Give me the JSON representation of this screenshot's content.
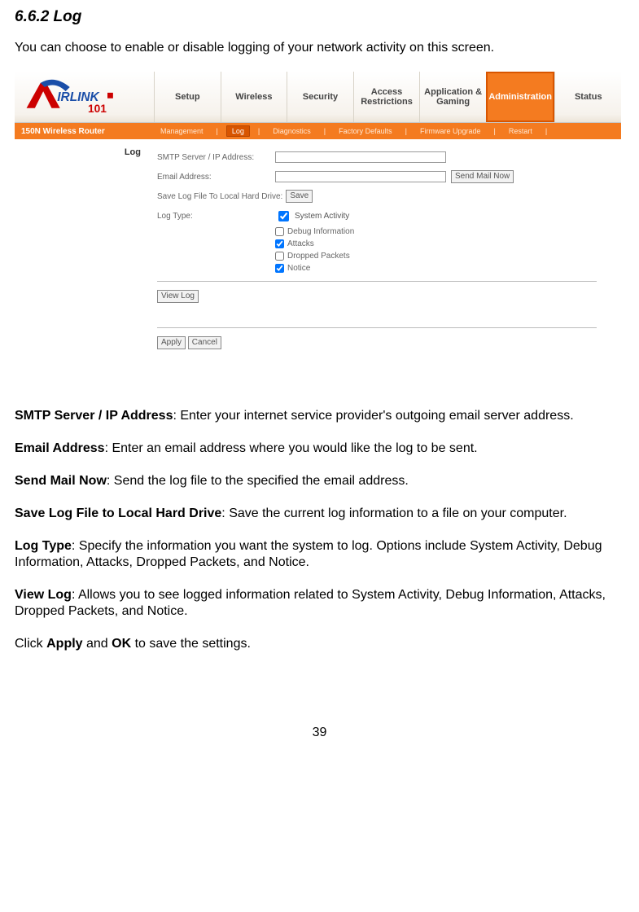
{
  "doc": {
    "heading": "6.6.2 Log",
    "intro": "You can choose to enable or disable logging of your network activity on this screen.",
    "page_number": "39"
  },
  "screenshot": {
    "router_model": "150N Wireless Router",
    "tabs": {
      "setup": "Setup",
      "wireless": "Wireless",
      "security": "Security",
      "access": "Access\nRestrictions",
      "app": "Application &\nGaming",
      "admin": "Administration",
      "status": "Status"
    },
    "subnav": {
      "management": "Management",
      "log": "Log",
      "diagnostics": "Diagnostics",
      "factory": "Factory Defaults",
      "firmware": "Firmware Upgrade",
      "restart": "Restart"
    },
    "panel_title": "Log",
    "form": {
      "smtp_label": "SMTP Server / IP Address:",
      "email_label": "Email Address:",
      "send_mail_btn": "Send Mail Now",
      "save_log_label": "Save Log File To Local Hard Drive:",
      "save_btn": "Save",
      "log_type_label": "Log Type:",
      "opts": {
        "system_activity": "System Activity",
        "debug_info": "Debug Information",
        "attacks": "Attacks",
        "dropped": "Dropped Packets",
        "notice": "Notice"
      },
      "view_log_btn": "View Log",
      "apply_btn": "Apply",
      "cancel_btn": "Cancel"
    }
  },
  "desc": {
    "p1_bold": "SMTP Server / IP Address",
    "p1_rest": ":  Enter your internet service provider's outgoing email server address.",
    "p2_bold": "Email Address",
    "p2_rest": ": Enter an email address where you would like the log to be sent.",
    "p3_bold": "Send Mail Now",
    "p3_rest": ": Send the log file to the specified the email address.",
    "p4_bold": "Save Log File to Local Hard Drive",
    "p4_rest": ": Save the current log information to a file on your computer.",
    "p5_bold": "Log Type",
    "p5_rest": ": Specify the information you want the system to log. Options include System Activity, Debug Information, Attacks, Dropped Packets, and Notice.",
    "p6_bold": "View Log",
    "p6_rest": ": Allows you to see logged information related to System Activity, Debug Information, Attacks, Dropped Packets, and Notice.",
    "p7_a": "Click ",
    "p7_b": "Apply",
    "p7_c": " and ",
    "p7_d": "OK",
    "p7_e": " to save the settings."
  }
}
